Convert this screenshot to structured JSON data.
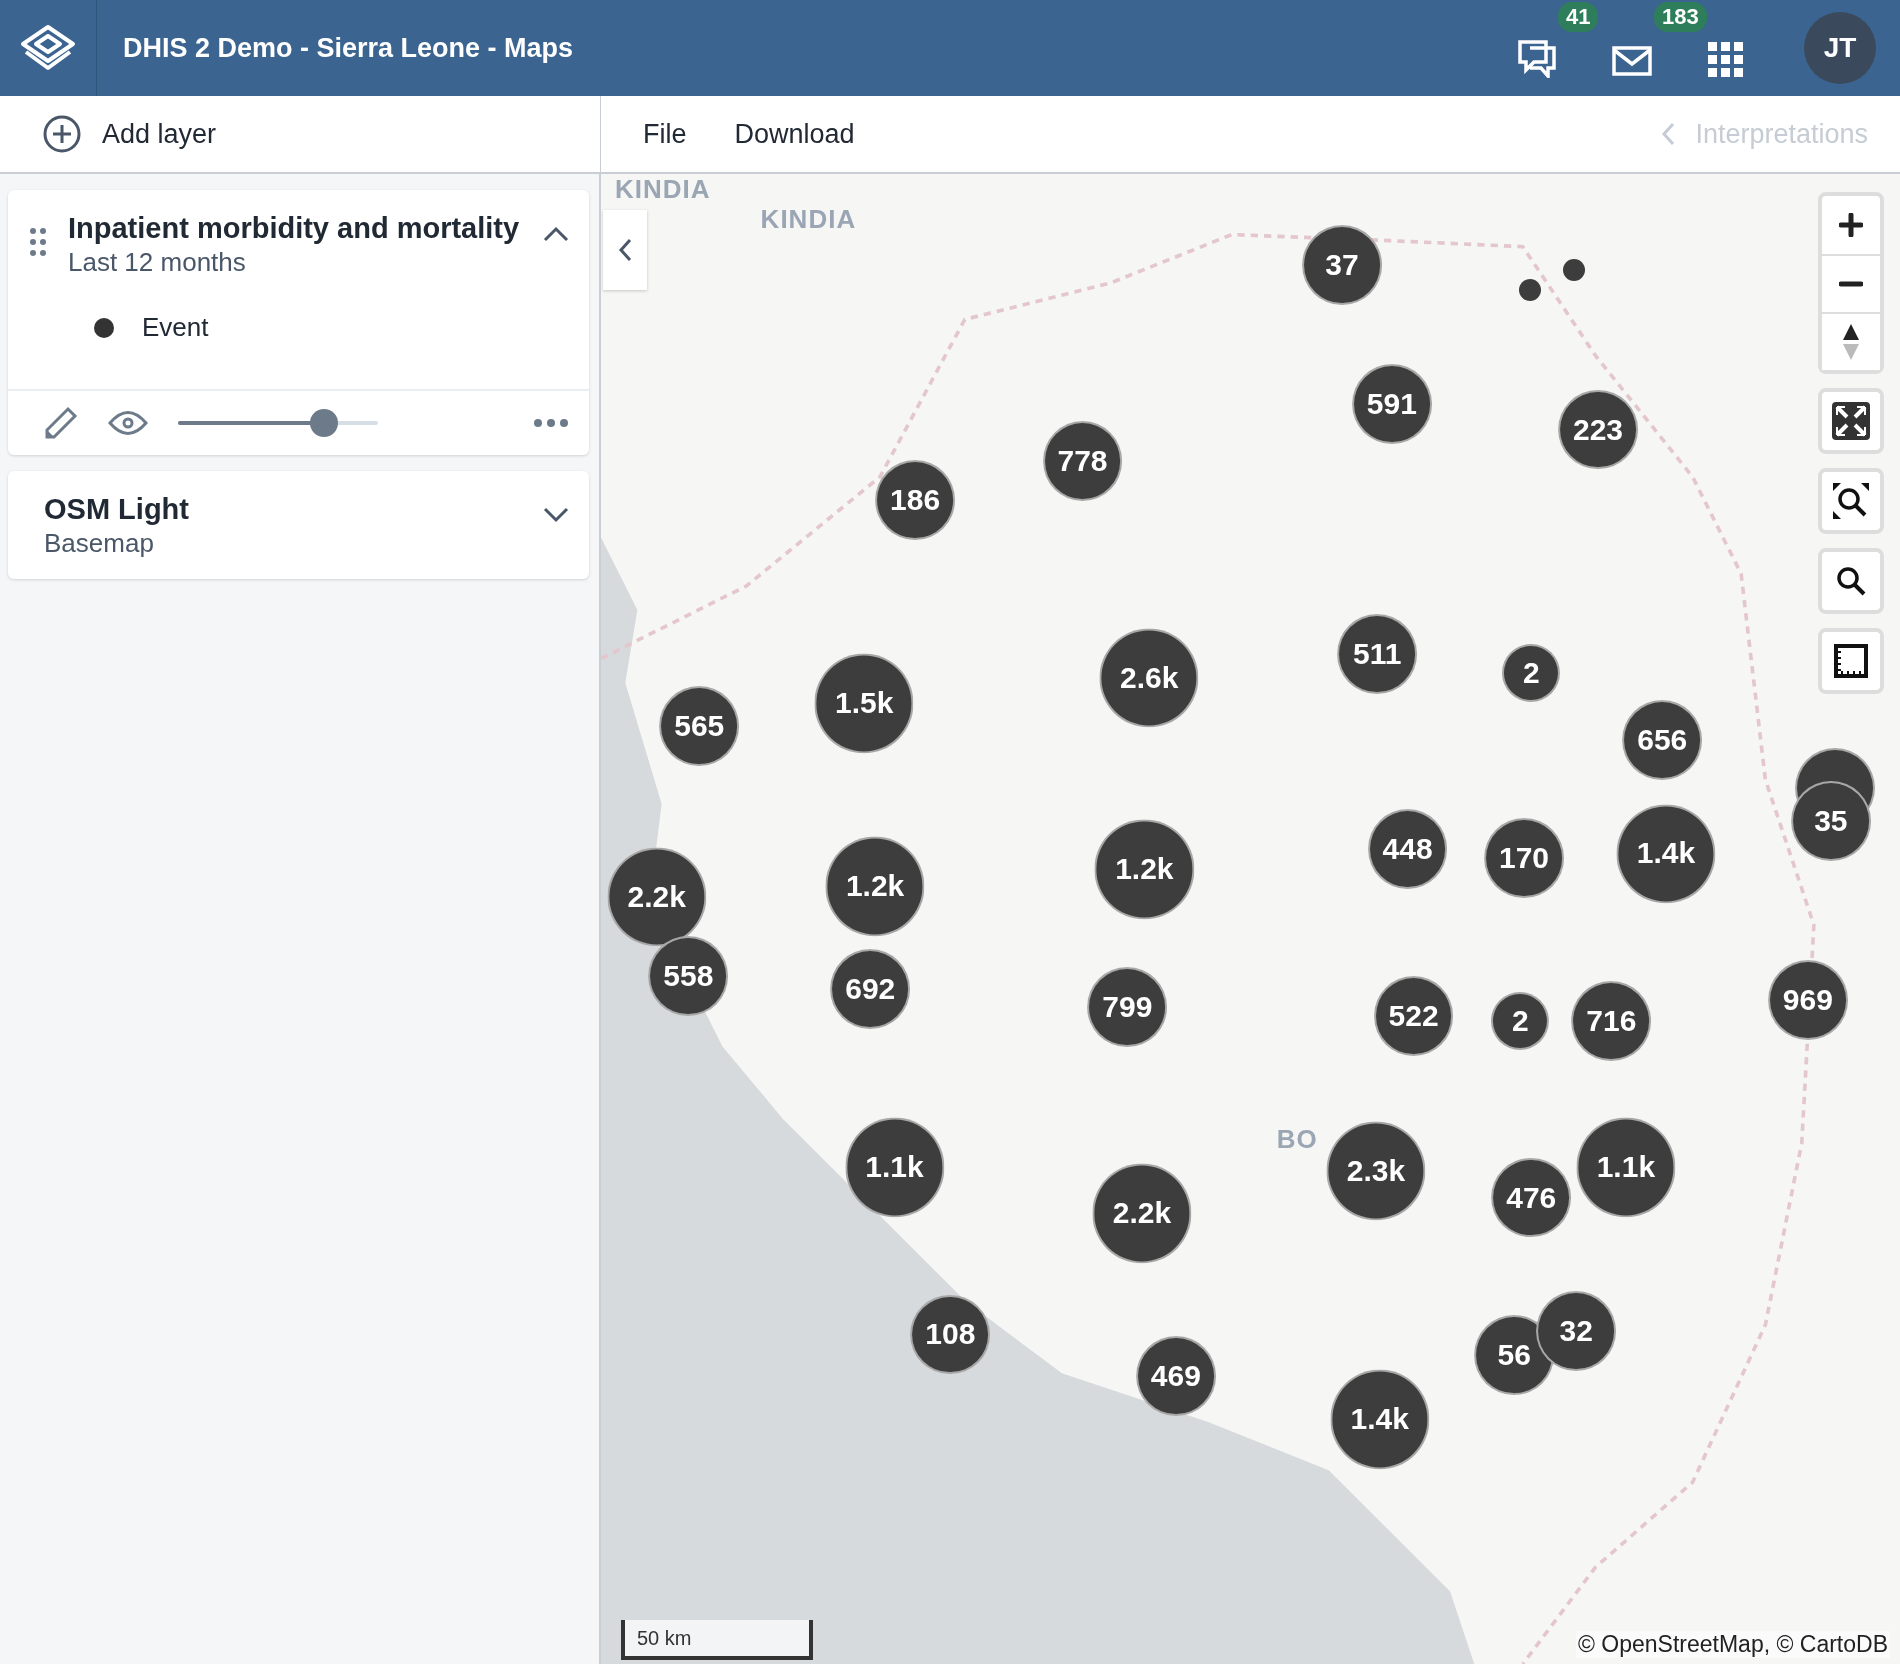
{
  "header": {
    "title": "DHIS 2 Demo - Sierra Leone - Maps",
    "interpretations_badge": "41",
    "messages_badge": "183",
    "avatar": "JT"
  },
  "toolbar": {
    "add_layer": "Add layer",
    "menus": [
      "File",
      "Download"
    ],
    "interpretations": {
      "label": "Interpretations",
      "disabled": true
    }
  },
  "layers": [
    {
      "kind": "thematic",
      "title": "Inpatient morbidity and mortality",
      "subtitle": "Last 12 months",
      "expanded": true,
      "visible": true,
      "legend": [
        {
          "label": "Event",
          "color": "#333333"
        }
      ],
      "opacity": {
        "level": 0.77
      }
    },
    {
      "kind": "basemap",
      "title": "OSM Light",
      "subtitle": "Basemap",
      "expanded": false
    }
  ],
  "map": {
    "place_labels": [
      "KINDIA",
      "KINDIA",
      "BO"
    ],
    "clusters": [
      "37",
      "186",
      "778",
      "591",
      "223",
      "565",
      "1.5k",
      "2.6k",
      "511",
      "2",
      "656",
      "2.2k",
      "1.2k",
      "1.2k",
      "448",
      "170",
      "1.4k",
      "35",
      "558",
      "692",
      "799",
      "522",
      "2",
      "716",
      "969",
      "1.1k",
      "2.2k",
      "2.3k",
      "476",
      "1.1k",
      "108",
      "469",
      "1.4k",
      "56",
      "32"
    ],
    "scale": "50 km",
    "attribution": "© OpenStreetMap, © CartoDB"
  }
}
